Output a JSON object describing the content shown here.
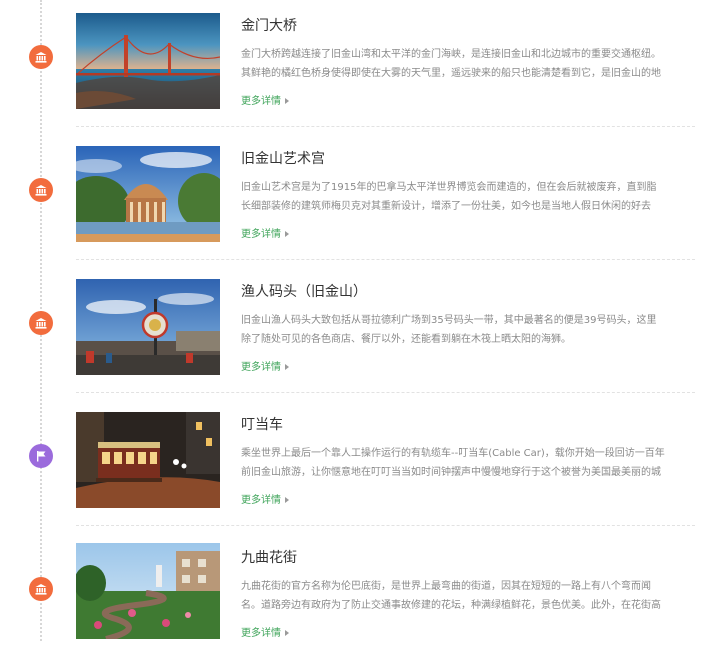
{
  "colors": {
    "timeline": "#d7d7d7",
    "landmark_marker": "#f26c3d",
    "transport_marker": "#9b6bdc",
    "link": "#3fa45a",
    "title": "#333333",
    "text": "#8a8a8a"
  },
  "entries": [
    {
      "icon": "landmark-icon",
      "marker_color": "#f26c3d",
      "image": "golden-gate-bridge-photo",
      "title": "金门大桥",
      "desc_line1": "金门大桥跨越连接了旧金山湾和太平洋的金门海峡，是连接旧金山和北边城市的重要交通枢纽。",
      "desc_line2": "其鲜艳的橘红色桥身使得即使在大雾的天气里，遥远驶来的船只也能清楚看到它，是旧金山的地",
      "more": "更多详情"
    },
    {
      "icon": "landmark-icon",
      "marker_color": "#f26c3d",
      "image": "palace-of-fine-arts-photo",
      "title": "旧金山艺术宫",
      "desc_line1": "旧金山艺术宫是为了1915年的巴拿马太平洋世界博览会而建造的，但在会后就被废弃，直到脂",
      "desc_line2": "长细部装修的建筑师梅贝克对其重新设计，增添了一份壮美，如今也是当地人假日休闲的好去",
      "more": "更多详情"
    },
    {
      "icon": "landmark-icon",
      "marker_color": "#f26c3d",
      "image": "fishermans-wharf-photo",
      "title": "渔人码头（旧金山）",
      "desc_line1": "旧金山渔人码头大致包括从哥拉德利广场到35号码头一带，其中最著名的便是39号码头，这里",
      "desc_line2": "除了随处可见的各色商店、餐厅以外，还能看到躺在木筏上晒太阳的海狮。",
      "more": "更多详情"
    },
    {
      "icon": "flag-icon",
      "marker_color": "#9b6bdc",
      "image": "cable-car-photo",
      "title": "叮当车",
      "desc_line1": "乘坐世界上最后一个靠人工操作运行的有轨缆车--叮当车(Cable Car)，载你开始一段回访一百年",
      "desc_line2": "前旧金山旅游，让你惬意地在叮叮当当如时间钟摆声中慢慢地穿行于这个被誉为美国最美丽的城",
      "more": "更多详情"
    },
    {
      "icon": "landmark-icon",
      "marker_color": "#f26c3d",
      "image": "lombard-street-photo",
      "title": "九曲花街",
      "desc_line1": "九曲花街的官方名称为伦巴底街，是世界上最弯曲的街道，因其在短短的一路上有八个弯而闻",
      "desc_line2": "名。道路旁边有政府为了防止交通事故修建的花坛，种满绿植鲜花，景色优美。此外，在花街高",
      "more": "更多详情"
    }
  ]
}
